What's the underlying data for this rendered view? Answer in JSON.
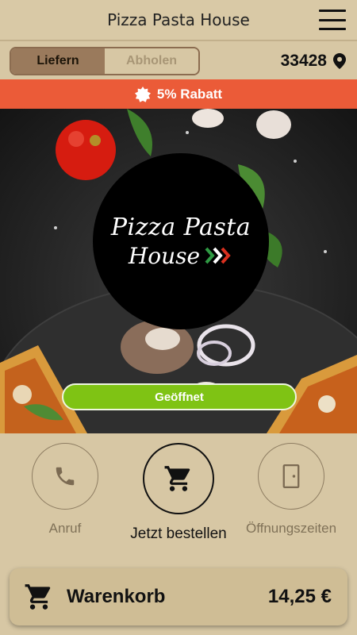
{
  "header": {
    "title": "Pizza Pasta House"
  },
  "order_mode": {
    "delivery_label": "Liefern",
    "pickup_label": "Abholen",
    "selected": "Liefern"
  },
  "location": {
    "zip": "33428"
  },
  "discount": {
    "label": "5% Rabatt"
  },
  "hero": {
    "logo_line1": "Pizza Pasta",
    "logo_line2": "House",
    "status_label": "Geöffnet"
  },
  "actions": {
    "call_label": "Anruf",
    "order_label": "Jetzt bestellen",
    "hours_label": "Öffnungszeiten"
  },
  "cart": {
    "label": "Warenkorb",
    "total": "14,25 €"
  },
  "colors": {
    "background": "#d7c7a4",
    "accent_discount": "#eb5b38",
    "status_open": "#7fc314",
    "toggle_active": "#9a7a5c"
  },
  "icons": [
    "menu-icon",
    "location-pin-icon",
    "badge-icon",
    "phone-icon",
    "cart-icon",
    "door-icon"
  ]
}
